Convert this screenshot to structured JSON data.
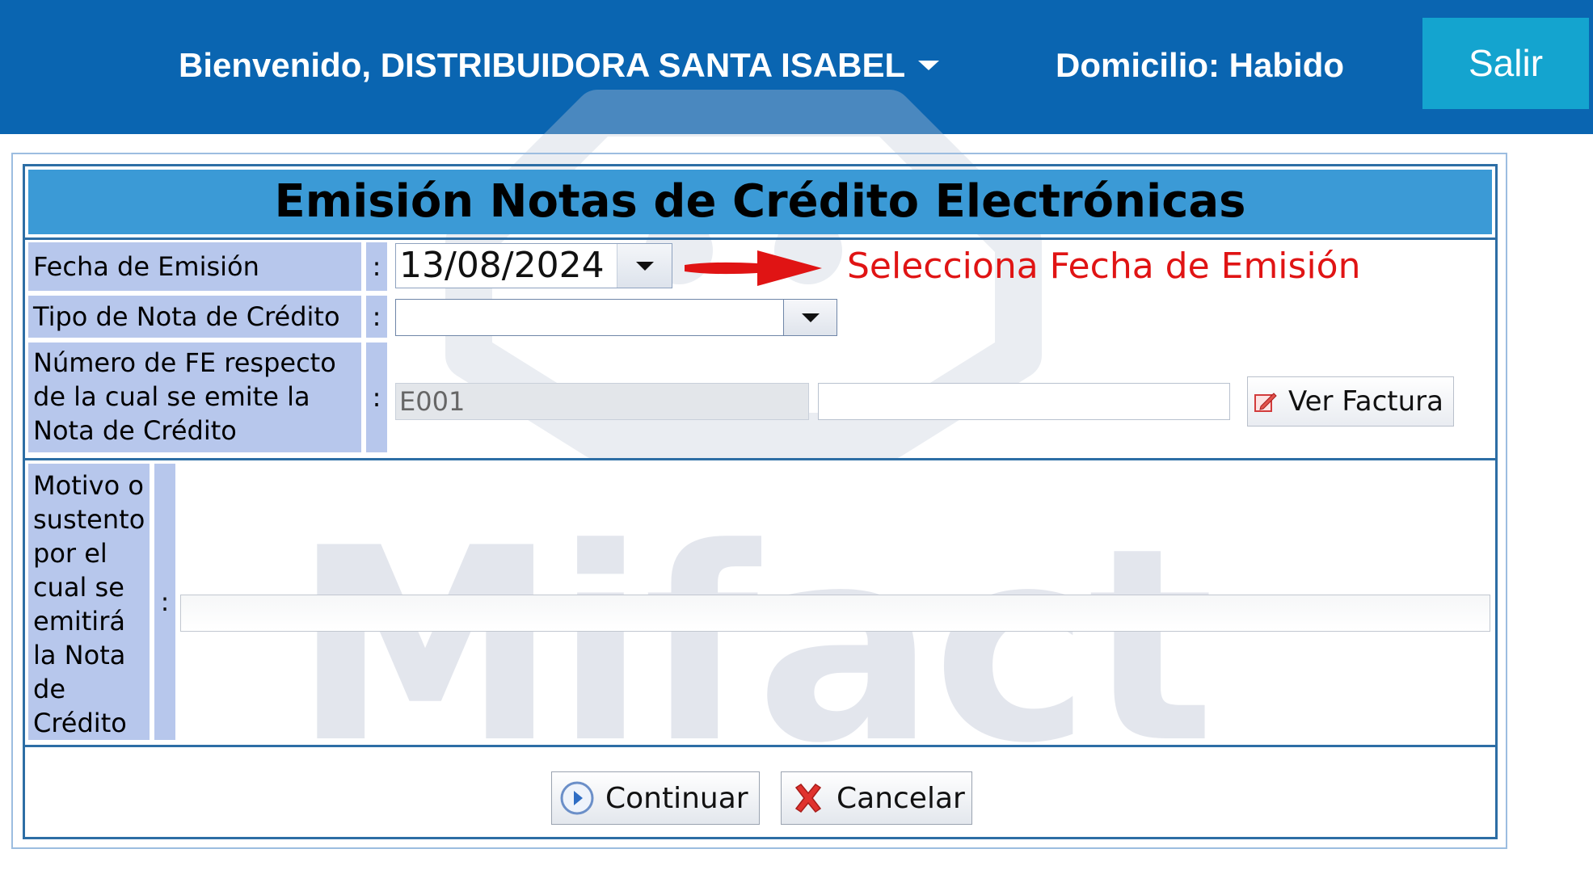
{
  "header": {
    "welcome_text": "Bienvenido, DISTRIBUIDORA SANTA ISABEL",
    "domicilio_text": "Domicilio: Habido",
    "logout_label": "Salir"
  },
  "watermark": {
    "text": "Mifact"
  },
  "form": {
    "title": "Emisión Notas de Crédito Electrónicas",
    "colon": ":",
    "fecha_label": "Fecha de Emisión",
    "fecha_value": "13/08/2024",
    "fecha_hint": "Selecciona Fecha de Emisión",
    "tipo_label": "Tipo de Nota de Crédito",
    "tipo_value": "",
    "fe_label": "Número de FE respecto de la cual se emite la Nota de Crédito",
    "fe_serie_value": "E001",
    "fe_numero_value": "",
    "ver_factura_label": "Ver Factura",
    "motivo_label": "Motivo o sustento por el cual se emitirá la Nota de Crédito",
    "motivo_value": ""
  },
  "actions": {
    "continuar_label": "Continuar",
    "cancelar_label": "Cancelar"
  },
  "colors": {
    "header_bg": "#0a65b1",
    "logout_bg": "#14a4cf",
    "title_bg": "#3b9ad6",
    "label_bg": "#b7c7ec",
    "hint_red": "#e01414"
  },
  "icons": {
    "user_menu": "chevron-down-icon",
    "date_picker": "chevron-down-icon",
    "select_toggle": "chevron-down-icon",
    "hint": "red-arrow-right-icon",
    "ver_factura": "edit-document-icon",
    "continuar": "play-circle-icon",
    "cancelar": "red-x-icon"
  }
}
